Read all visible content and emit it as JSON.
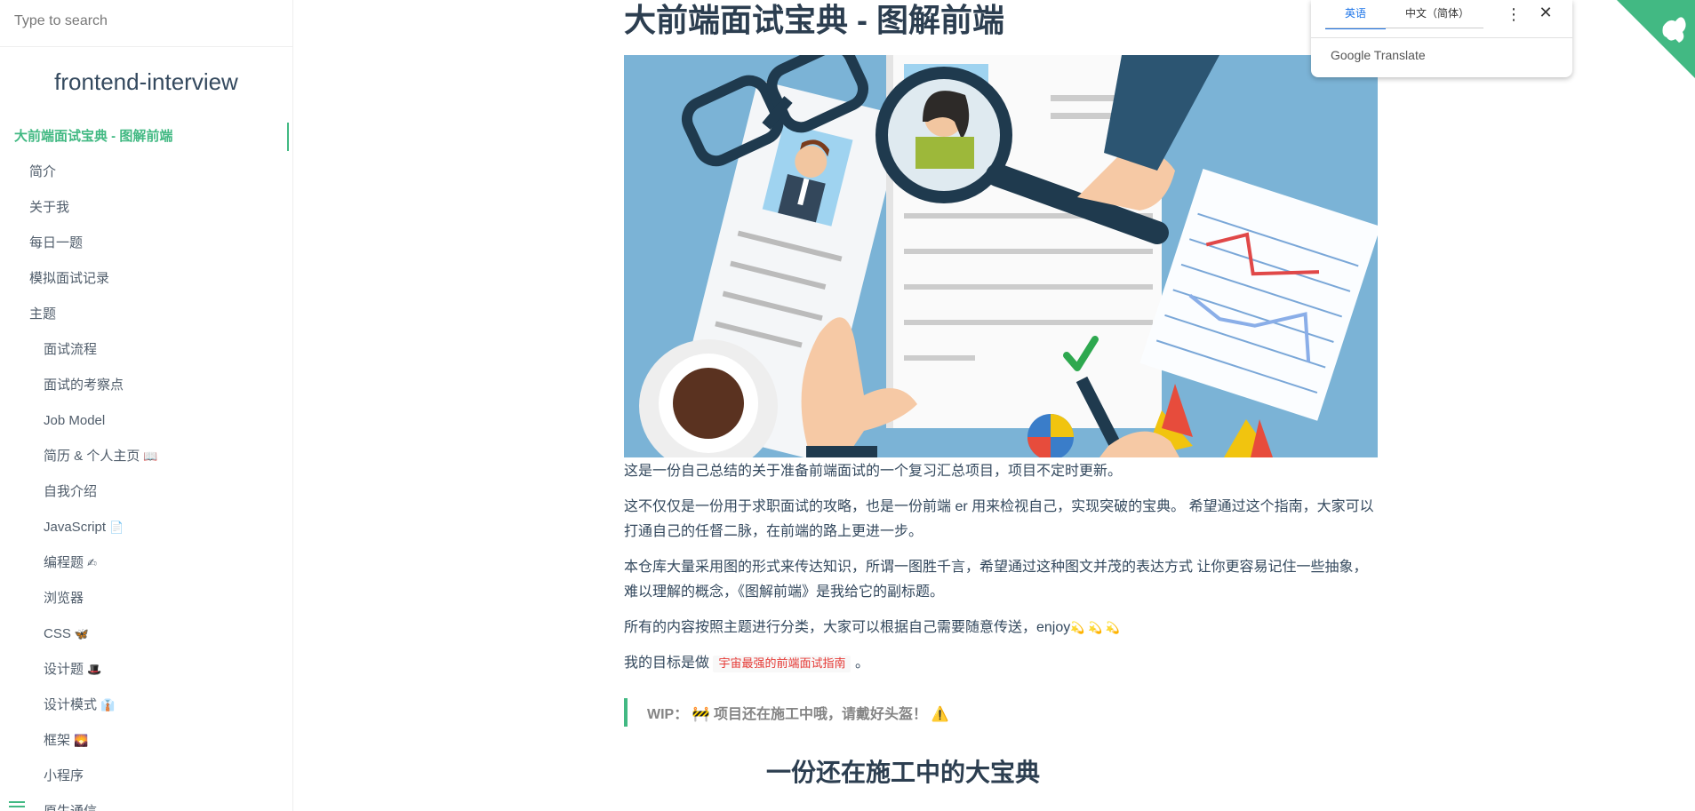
{
  "search": {
    "placeholder": "Type to search"
  },
  "sidebar": {
    "app_name": "frontend-interview",
    "items": [
      {
        "label": "大前端面试宝典 - 图解前端",
        "level": 0,
        "active": true,
        "emoji": ""
      },
      {
        "label": "简介",
        "level": 1,
        "emoji": ""
      },
      {
        "label": "关于我",
        "level": 1,
        "emoji": ""
      },
      {
        "label": "每日一题",
        "level": 1,
        "emoji": ""
      },
      {
        "label": "模拟面试记录",
        "level": 1,
        "emoji": ""
      },
      {
        "label": "主题",
        "level": 1,
        "emoji": ""
      },
      {
        "label": "面试流程",
        "level": 2,
        "emoji": ""
      },
      {
        "label": "面试的考察点",
        "level": 2,
        "emoji": ""
      },
      {
        "label": "Job Model",
        "level": 2,
        "emoji": ""
      },
      {
        "label": "简历 & 个人主页",
        "level": 2,
        "emoji": "📖"
      },
      {
        "label": "自我介绍",
        "level": 2,
        "emoji": ""
      },
      {
        "label": "JavaScript",
        "level": 2,
        "emoji": "📄"
      },
      {
        "label": "编程题",
        "level": 2,
        "emoji": "✍"
      },
      {
        "label": "浏览器",
        "level": 2,
        "emoji": ""
      },
      {
        "label": "CSS",
        "level": 2,
        "emoji": "🦋"
      },
      {
        "label": "设计题",
        "level": 2,
        "emoji": "🎩"
      },
      {
        "label": "设计模式",
        "level": 2,
        "emoji": "👔"
      },
      {
        "label": "框架",
        "level": 2,
        "emoji": "🌄"
      },
      {
        "label": "小程序",
        "level": 2,
        "emoji": ""
      },
      {
        "label": "原生通信",
        "level": 2,
        "emoji": ""
      }
    ]
  },
  "main": {
    "title": "大前端面试宝典 - 图解前端",
    "p1": "这是一份自己总结的关于准备前端面试的一个复习汇总项目，项目不定时更新。",
    "p2": "这不仅仅是一份用于求职面试的攻略，也是一份前端 er 用来检视自己，实现突破的宝典。 希望通过这个指南，大家可以打通自己的任督二脉，在前端的路上更进一步。",
    "p3": "本仓库大量采用图的形式来传达知识，所谓一图胜千言，希望通过这种图文并茂的表达方式 让你更容易记住一些抽象，难以理解的概念，《图解前端》是我给它的副标题。",
    "p4": "所有的内容按照主题进行分类，大家可以根据自己需要随意传送，enjoy",
    "p4_emoji": "💫 💫 💫",
    "p5_prefix": "我的目标是做",
    "p5_tag": "宇宙最强的前端面试指南",
    "p5_suffix": "。",
    "wip_label": "WIP：",
    "wip_text": "🚧 项目还在施工中哦，请戴好头盔！ ⚠️",
    "next_heading": "一份还在施工中的大宝典"
  },
  "translate": {
    "tab_source": "英语",
    "tab_target": "中文（简体）",
    "brand": "Google Translate"
  },
  "colors": {
    "accent": "#42b983",
    "text": "#34495e",
    "hero_bg": "#7bb3d6"
  }
}
